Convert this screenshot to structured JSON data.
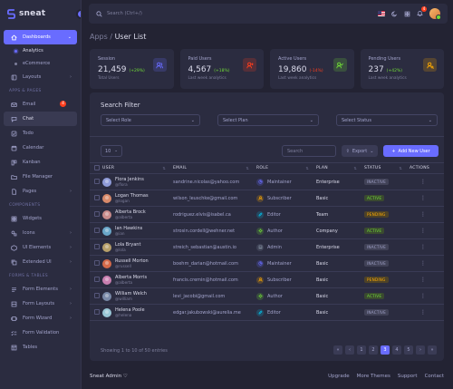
{
  "brand": {
    "name": "sneat"
  },
  "colors": {
    "primary": "#696cff",
    "success": "#71dd37",
    "danger": "#ff3e1d",
    "warning": "#ffab00",
    "info": "#03c3ec"
  },
  "sidebar": {
    "dashboards": {
      "label": "Dashboards",
      "icon": "home-icon"
    },
    "analytics": "Analytics",
    "ecommerce": "eCommerce",
    "layouts": "Layouts",
    "sections": {
      "apps_pages": "APPS & PAGES",
      "components": "COMPONENTS",
      "forms_tables": "FORMS & TABLES"
    },
    "email": {
      "label": "Email",
      "badge": "4"
    },
    "chat": "Chat",
    "todo": "Todo",
    "calendar": "Calendar",
    "kanban": "Kanban",
    "file_manager": "File Manager",
    "pages": "Pages",
    "widgets": "Widgets",
    "icons": "Icons",
    "ui_elements": "UI Elements",
    "extended_ui": "Extended UI",
    "form_elements": "Form Elements",
    "form_layouts": "Form Layouts",
    "form_wizard": "Form Wizard",
    "form_validation": "Form Validation",
    "tables": "Tables"
  },
  "topbar": {
    "search_placeholder": "Search (Ctrl+/)",
    "notification_count": "4"
  },
  "breadcrumb": {
    "parent": "Apps / ",
    "current": "User List"
  },
  "stats": [
    {
      "label": "Session",
      "value": "21,459",
      "change": "(+29%)",
      "trend": "up",
      "sub": "Total Users",
      "icon": "users-icon",
      "icon_color": "#696cff"
    },
    {
      "label": "Paid Users",
      "value": "4,567",
      "change": "(+18%)",
      "trend": "up",
      "sub": "Last week analytics",
      "icon": "user-plus-icon",
      "icon_color": "#ff3e1d"
    },
    {
      "label": "Active Users",
      "value": "19,860",
      "change": "(-14%)",
      "trend": "down",
      "sub": "Last week analytics",
      "icon": "user-check-icon",
      "icon_color": "#71dd37"
    },
    {
      "label": "Pending Users",
      "value": "237",
      "change": "(+42%)",
      "trend": "up",
      "sub": "Last week analytics",
      "icon": "user-search-icon",
      "icon_color": "#ffab00"
    }
  ],
  "filters": {
    "title": "Search Filter",
    "role": "Select Role",
    "plan": "Select Plan",
    "status": "Select Status"
  },
  "controls": {
    "page_size": "10",
    "search_placeholder": "Search",
    "export_label": "Export",
    "add_label": "Add New User"
  },
  "table": {
    "headers": [
      "USER",
      "EMAIL",
      "ROLE",
      "PLAN",
      "STATUS",
      "ACTIONS"
    ],
    "rows": [
      {
        "name": "Flora Jenkins",
        "handle": "@flora",
        "email": "sandrine.nicolas@yahoo.com",
        "role": "Maintainer",
        "role_key": "maintainer",
        "plan": "Enterprise",
        "status": "INACTIVE",
        "status_key": "inactive",
        "avatar": "#8f9bd8"
      },
      {
        "name": "Logan Thomas",
        "handle": "@logan",
        "email": "wilson_leuschke@gmail.com",
        "role": "Subscriber",
        "role_key": "subscriber",
        "plan": "Basic",
        "status": "ACTIVE",
        "status_key": "active",
        "avatar": "#d98a6a"
      },
      {
        "name": "Alberta Brock",
        "handle": "@alberta",
        "email": "rodriguez.elvis@isabel.ca",
        "role": "Editor",
        "role_key": "editor",
        "plan": "Team",
        "status": "PENDING",
        "status_key": "pending",
        "avatar": "#c98b8b"
      },
      {
        "name": "Ian Hawkins",
        "handle": "@ian",
        "email": "strosin.cordell@wehner.net",
        "role": "Author",
        "role_key": "author",
        "plan": "Company",
        "status": "ACTIVE",
        "status_key": "active",
        "avatar": "#6aa7c9"
      },
      {
        "name": "Lola Bryant",
        "handle": "@lola",
        "email": "streich_sebastian@austin.io",
        "role": "Admin",
        "role_key": "admin",
        "plan": "Enterprise",
        "status": "INACTIVE",
        "status_key": "inactive",
        "avatar": "#b7a06a"
      },
      {
        "name": "Russell Morton",
        "handle": "@russell",
        "email": "boehm_darian@hotmail.com",
        "role": "Maintainer",
        "role_key": "maintainer",
        "plan": "Basic",
        "status": "INACTIVE",
        "status_key": "inactive",
        "avatar": "#d46a4a"
      },
      {
        "name": "Alberta Morris",
        "handle": "@alberta",
        "email": "francis.cremin@hotmail.com",
        "role": "Subscriber",
        "role_key": "subscriber",
        "plan": "Basic",
        "status": "PENDING",
        "status_key": "pending",
        "avatar": "#c97fb0"
      },
      {
        "name": "William Welch",
        "handle": "@william",
        "email": "levi_jacobi@gmail.com",
        "role": "Author",
        "role_key": "author",
        "plan": "Basic",
        "status": "ACTIVE",
        "status_key": "active",
        "avatar": "#7a8aa8"
      },
      {
        "name": "Helena Poole",
        "handle": "@helena",
        "email": "edgar.jakubowski@aurelia.me",
        "role": "Editor",
        "role_key": "editor",
        "plan": "Basic",
        "status": "INACTIVE",
        "status_key": "inactive",
        "avatar": "#9ac7d6"
      }
    ]
  },
  "pagination": {
    "info": "Showing 1 to 10 of 50 entries",
    "pages": [
      "«",
      "‹",
      "1",
      "2",
      "3",
      "4",
      "5",
      "›",
      "»"
    ],
    "active": "3"
  },
  "footer": {
    "brand": "Sneat Admin",
    "links": [
      "Upgrade",
      "More Themes",
      "Support",
      "Contact"
    ]
  }
}
